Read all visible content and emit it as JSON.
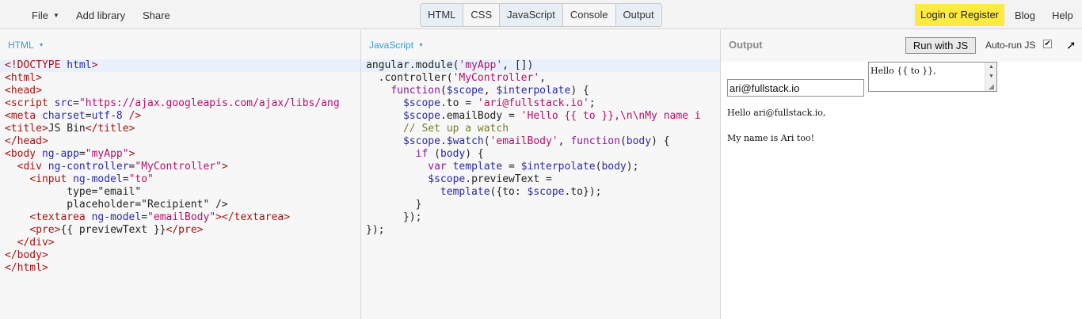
{
  "menu": {
    "file": "File",
    "add_library": "Add library",
    "share": "Share"
  },
  "panel_toggles": [
    {
      "label": "HTML",
      "active": true
    },
    {
      "label": "CSS",
      "active": false
    },
    {
      "label": "JavaScript",
      "active": true
    },
    {
      "label": "Console",
      "active": false
    },
    {
      "label": "Output",
      "active": true
    }
  ],
  "account": {
    "login": "Login or Register",
    "blog": "Blog",
    "help": "Help"
  },
  "html_panel": {
    "label": "HTML",
    "lines": [
      "<!DOCTYPE html>",
      "<html>",
      "<head>",
      "<script src=\"https://ajax.googleapis.com/ajax/libs/ang",
      "<meta charset=utf-8 />",
      "<title>JS Bin</title>",
      "</head>",
      "<body ng-app=\"myApp\">",
      "  <div ng-controller=\"MyController\">",
      "    <input ng-model=\"to\"",
      "          type=\"email\"",
      "          placeholder=\"Recipient\" />",
      "    <textarea ng-model=\"emailBody\"></textarea>",
      "    <pre>{{ previewText }}</pre>",
      "  </div>",
      "</body>",
      "</html>"
    ]
  },
  "js_panel": {
    "label": "JavaScript",
    "lines": [
      "angular.module('myApp', [])",
      "  .controller('MyController',",
      "    function($scope, $interpolate) {",
      "      $scope.to = 'ari@fullstack.io';",
      "      $scope.emailBody = 'Hello {{ to }},\\n\\nMy name i",
      "      // Set up a watch",
      "      $scope.$watch('emailBody', function(body) {",
      "        if (body) {",
      "          var template = $interpolate(body);",
      "          $scope.previewText =",
      "            template({to: $scope.to});",
      "        }",
      "      });",
      "});"
    ]
  },
  "output_panel": {
    "label": "Output",
    "run_button": "Run with JS",
    "autorun_label": "Auto-run JS",
    "autorun_checked": true,
    "email_value": "ari@fullstack.io",
    "email_placeholder": "Recipient",
    "textarea_value": "Hello {{ to }},",
    "preview_text": "Hello ari@fullstack.io,\n\nMy name is Ari too!"
  },
  "icons": {
    "caret": "caret-down-icon",
    "popout": "popout-arrow-icon",
    "checkbox": "checkbox-checked-icon"
  }
}
